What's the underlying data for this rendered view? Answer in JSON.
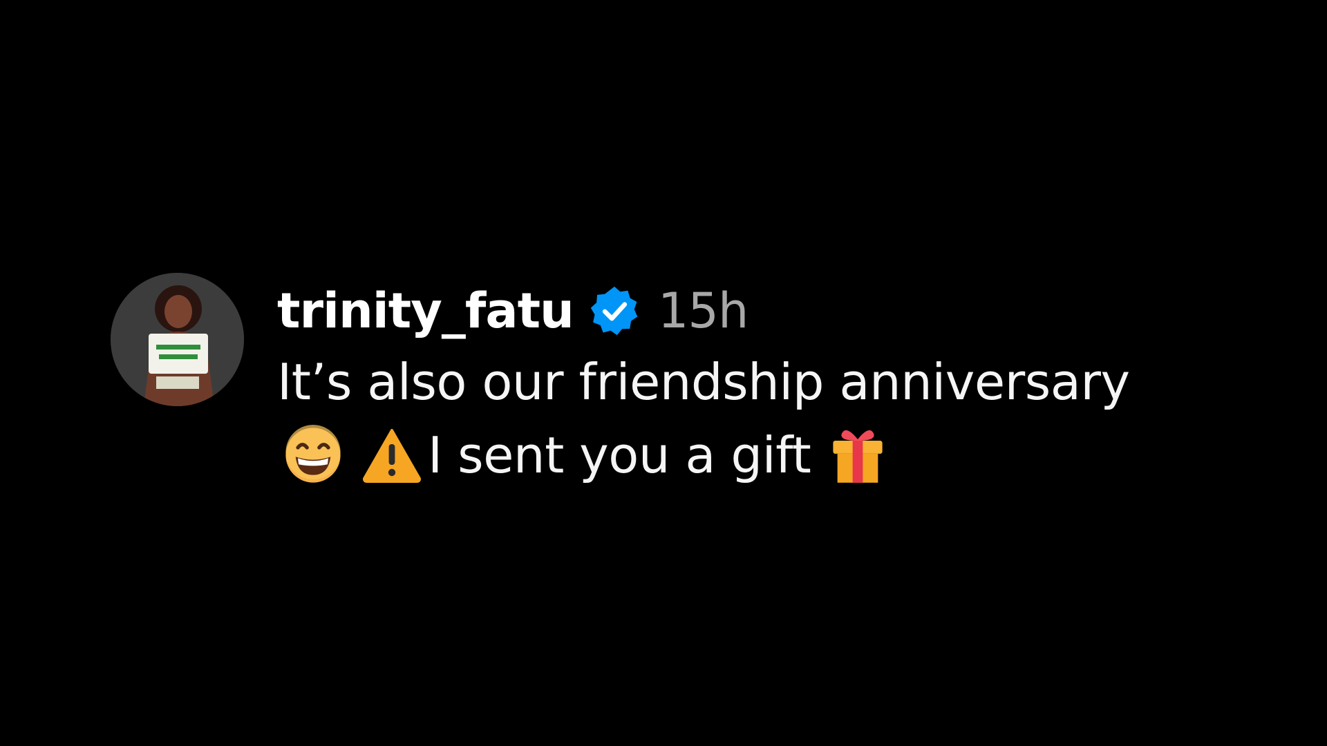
{
  "comment": {
    "username": "trinity_fatu",
    "verified": true,
    "timestamp": "15h",
    "line1": "It’s also our friendship anniversary",
    "line2_text": "I sent you a gift",
    "emojis": [
      "grinning-face-icon",
      "warning-icon",
      "gift-icon"
    ]
  },
  "colors": {
    "background": "#000000",
    "username": "#ffffff",
    "timestamp": "#a8a8a8",
    "verified_badge": "#0095f6",
    "text": "#f5f5f5"
  }
}
